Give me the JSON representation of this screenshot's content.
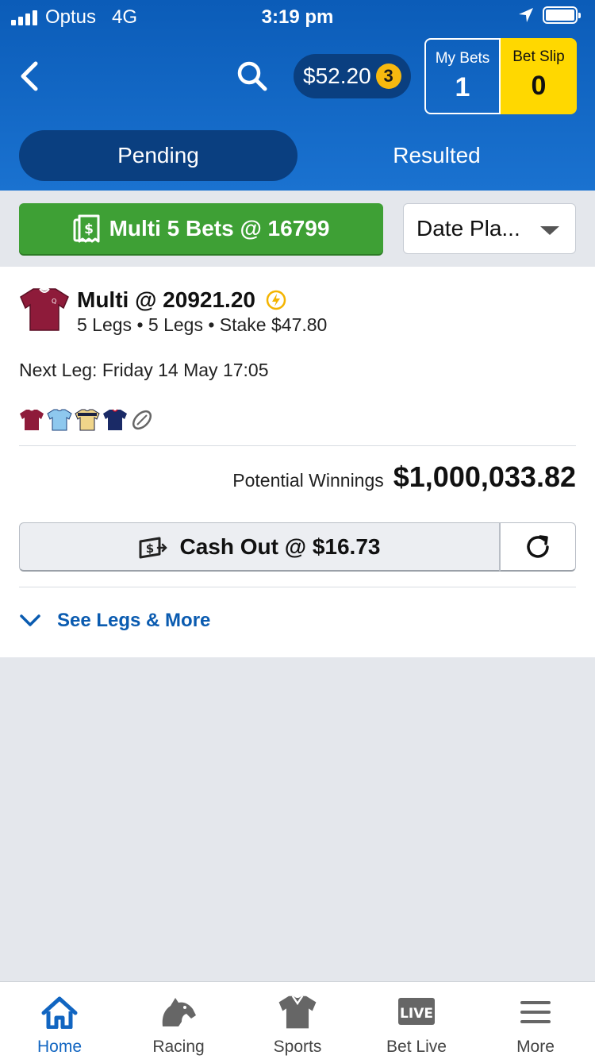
{
  "status_bar": {
    "carrier": "Optus",
    "network": "4G",
    "time": "3:19 pm"
  },
  "header": {
    "balance": "$52.20",
    "balance_badge": "3",
    "my_bets": {
      "label": "My Bets",
      "count": "1"
    },
    "bet_slip": {
      "label": "Bet Slip",
      "count": "0"
    },
    "tabs": [
      {
        "label": "Pending",
        "active": true
      },
      {
        "label": "Resulted",
        "active": false
      }
    ]
  },
  "filter": {
    "multi_button": "Multi 5 Bets @ 16799",
    "sort_select": "Date Pla..."
  },
  "bet": {
    "title": "Multi @ 20921.20",
    "subtitle": "5 Legs • 5 Legs • Stake $47.80",
    "next_leg": "Next Leg: Friday 14 May 17:05",
    "potential_label": "Potential Winnings",
    "potential_amount": "$1,000,033.82",
    "cashout_label": "Cash Out @ $16.73",
    "see_legs": "See Legs & More",
    "jerseys": [
      "maroon-jersey",
      "sky-blue-jersey",
      "navy-gold-jersey",
      "navy-red-jersey",
      "football-icon"
    ]
  },
  "bottom_nav": [
    {
      "label": "Home",
      "icon": "home-icon",
      "active": true
    },
    {
      "label": "Racing",
      "icon": "horse-icon",
      "active": false
    },
    {
      "label": "Sports",
      "icon": "jersey-icon",
      "active": false
    },
    {
      "label": "Bet Live",
      "icon": "live-icon",
      "active": false
    },
    {
      "label": "More",
      "icon": "menu-icon",
      "active": false
    }
  ],
  "colors": {
    "header_blue": "#1a6fcc",
    "dark_blue": "#0a3f80",
    "bet_slip_yellow": "#ffd800",
    "multi_green": "#3ea035",
    "link_blue": "#0a5bb0"
  }
}
